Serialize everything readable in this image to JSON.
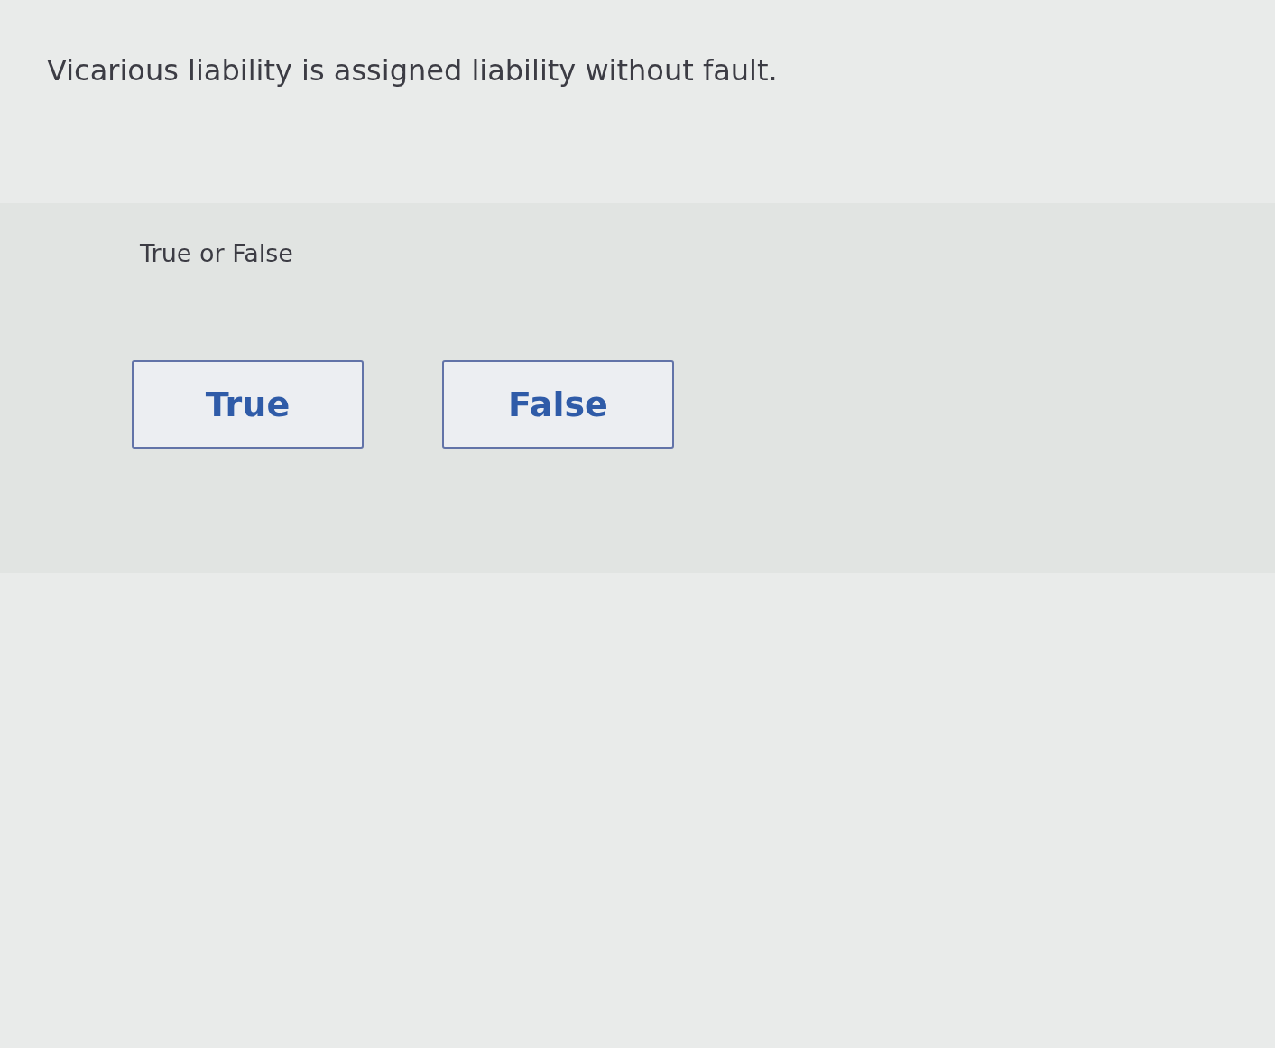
{
  "question": {
    "text": "Vicarious liability is assigned liability without fault."
  },
  "answer_panel": {
    "prompt": "True or False",
    "options": [
      {
        "label": "True",
        "selected": false
      },
      {
        "label": "False",
        "selected": false
      }
    ]
  }
}
